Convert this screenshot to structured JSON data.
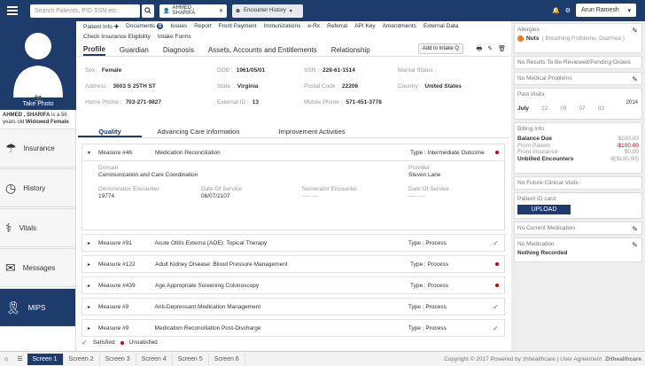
{
  "header": {
    "search_placeholder": "Search Patients, PID SSN etc.",
    "patient_chip": "AHMED , SHARIFA",
    "encounter_chip": "Encounter History",
    "user": "Arun Ramesh"
  },
  "patient": {
    "name_line": "AHMED , SHARIFA",
    "age_line": "is a 56 years old",
    "status": "Widowed Female",
    "take_photo": "Take Photo"
  },
  "sidebar": {
    "items": [
      {
        "label": "Insurance"
      },
      {
        "label": "History"
      },
      {
        "label": "Vitals"
      },
      {
        "label": "Messages"
      },
      {
        "label": "MIPS"
      }
    ]
  },
  "topnav": [
    "Patient Info",
    "Documents",
    "Issues",
    "Report",
    "Front Payment",
    "Immunizations",
    "e-Rx",
    "Referral",
    "API Key",
    "Amendments",
    "External Data",
    "Check Insurance Eligibility",
    "Intake Forms"
  ],
  "documents_badge": "0",
  "subnav": [
    "Profile",
    "Guardian",
    "Diagnosis",
    "Assets, Accounts and Entitlements",
    "Relationship"
  ],
  "intake_btn": "Add to intake Q",
  "demographics": {
    "sex_l": "Sex :",
    "sex": "Female",
    "dob_l": "DOB :",
    "dob": "1961/05/01",
    "ssn_l": "SSN :",
    "ssn": "228-61-1514",
    "marital_l": "Marital Status :",
    "marital": "",
    "address_l": "Address :",
    "address": "3603 S 25TH ST",
    "state_l": "State :",
    "state": "Virginia",
    "postal_l": "Postal Code :",
    "postal": "22206",
    "country_l": "Country :",
    "country": "United States",
    "home_l": "Home Phone :",
    "home": "703-271-9827",
    "extid_l": "External ID :",
    "extid": "13",
    "mobile_l": "Mobile Phone :",
    "mobile": "571-451-3778"
  },
  "qtabs": [
    "Quality",
    "Advancing Care Information",
    "Improvement Activities"
  ],
  "measures": [
    {
      "num": "Measure #46",
      "desc": "Medication Reconciliation",
      "type": "Type : Intermediate Outcome",
      "status": "red"
    },
    {
      "num": "Measure #91",
      "desc": "Acute Otitis Externa (AOE): Topical Therapy",
      "type": "Type : Process",
      "status": "check"
    },
    {
      "num": "Measure #122",
      "desc": "Adult Kidney Disease: Blood Pressure Management",
      "type": "Type : Process",
      "status": "red"
    },
    {
      "num": "Measure #439",
      "desc": "Age Appropriate Screening Colonoscopy",
      "type": "Type : Process",
      "status": "red"
    },
    {
      "num": "Measure #9",
      "desc": "Anti-Depressant Medication Management",
      "type": "Type : Process",
      "status": "check"
    },
    {
      "num": "Measure #9",
      "desc": "Medication Reconciliation Post-Discharge",
      "type": "Type : Process",
      "status": "check"
    }
  ],
  "detail": {
    "domain_l": "Domain",
    "domain": "Communication and Care Coordination",
    "provider_l": "Provider",
    "provider": "Steven Lane",
    "denom_l": "Denominator Encounter",
    "denom": "19774",
    "dos_l": "Date Of Service",
    "dos": "06/07/2107",
    "numer_l": "Numerator Encounter",
    "numer": "---- ----",
    "dos2_l": "Date Of Service",
    "dos2": "---- ----"
  },
  "legend": {
    "satisfied": "Satisfied",
    "unsatisfied": "Unsatisfied"
  },
  "right": {
    "allergies": "Allergies",
    "allergy_item": "Nuts",
    "allergy_note": "( Breathing Problems, Diarrhea )",
    "no_results": "No Results To Be Reviewed/Pending Orders",
    "no_problems": "No Medical Problems",
    "past_visits": "Past Visits",
    "year": "2014",
    "month": "July",
    "days": [
      "22",
      "09",
      "07",
      "03"
    ],
    "billing": "Billing Info",
    "balance_l": "Balance Due",
    "balance": "$100.00",
    "from_patient_l": "From Patient",
    "from_patient": "-$100.00",
    "from_ins_l": "From Insurance",
    "from_ins": "$0.00",
    "unbilled_l": "Unbilled Encounters",
    "unbilled": "6($100.00)",
    "no_future": "No Future Clinical Visits",
    "id_card": "Patient ID card",
    "upload": "UPLOAD",
    "no_curr_med": "No Current Medication",
    "no_med": "No Medication",
    "nothing": "Nothing Recorded"
  },
  "footer": {
    "screens": [
      "Screen 1",
      "Screen 2",
      "Screen 3",
      "Screen 4",
      "Screen 5",
      "Screen 6"
    ],
    "copyright": "Copyright © 2017 Powered by zhhealthcare | User Agreement",
    "brand": "ZHhealthcare"
  }
}
